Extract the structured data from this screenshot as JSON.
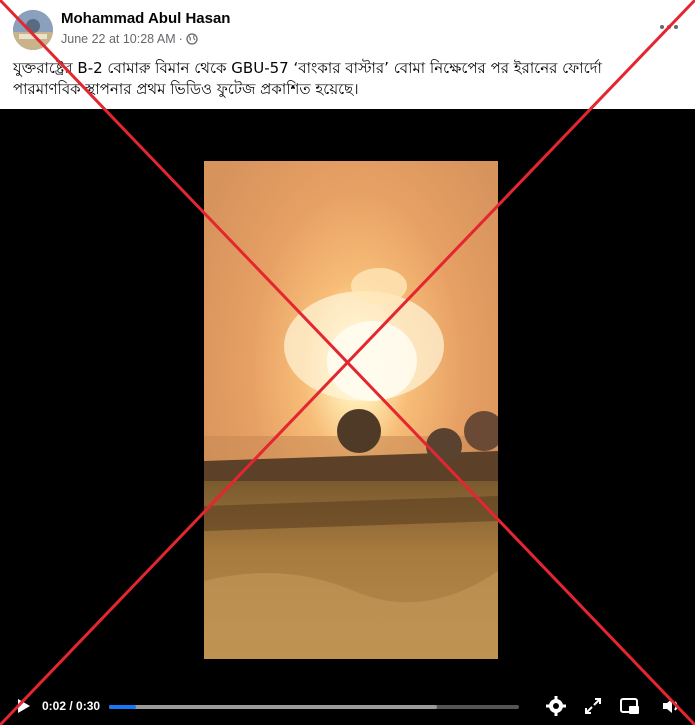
{
  "post": {
    "author": "Mohammad Abul Hasan",
    "date": "June 22 at 10:28 AM",
    "date_separator": "·",
    "audience_icon": "globe-icon",
    "more_icon": "more-options-icon",
    "caption_line1": "যুক্তরাষ্ট্রের B-2 বোমারু বিমান থেকে GBU-57 ‘বাংকার বাস্টার’ বোমা নিক্ষেপের পর ইরানের ফোর্দো",
    "caption_line2": "পারমাণবিক স্থাপনার প্রথম ভিডিও ফুটেজ প্রকাশিত হয়েছে।"
  },
  "video": {
    "current_time": "0:02",
    "duration": "0:30",
    "time_display": "0:02 / 0:30",
    "played_fraction": 0.067,
    "buffered_fraction": 0.8,
    "icons": [
      "play-icon",
      "settings-icon",
      "fullscreen-icon",
      "picture-in-picture-icon",
      "volume-icon"
    ]
  },
  "overlay": {
    "cross_color": "#e3262f"
  },
  "colors": {
    "accent": "#1877f2",
    "background": "#ffffff",
    "video_background": "#000000"
  }
}
